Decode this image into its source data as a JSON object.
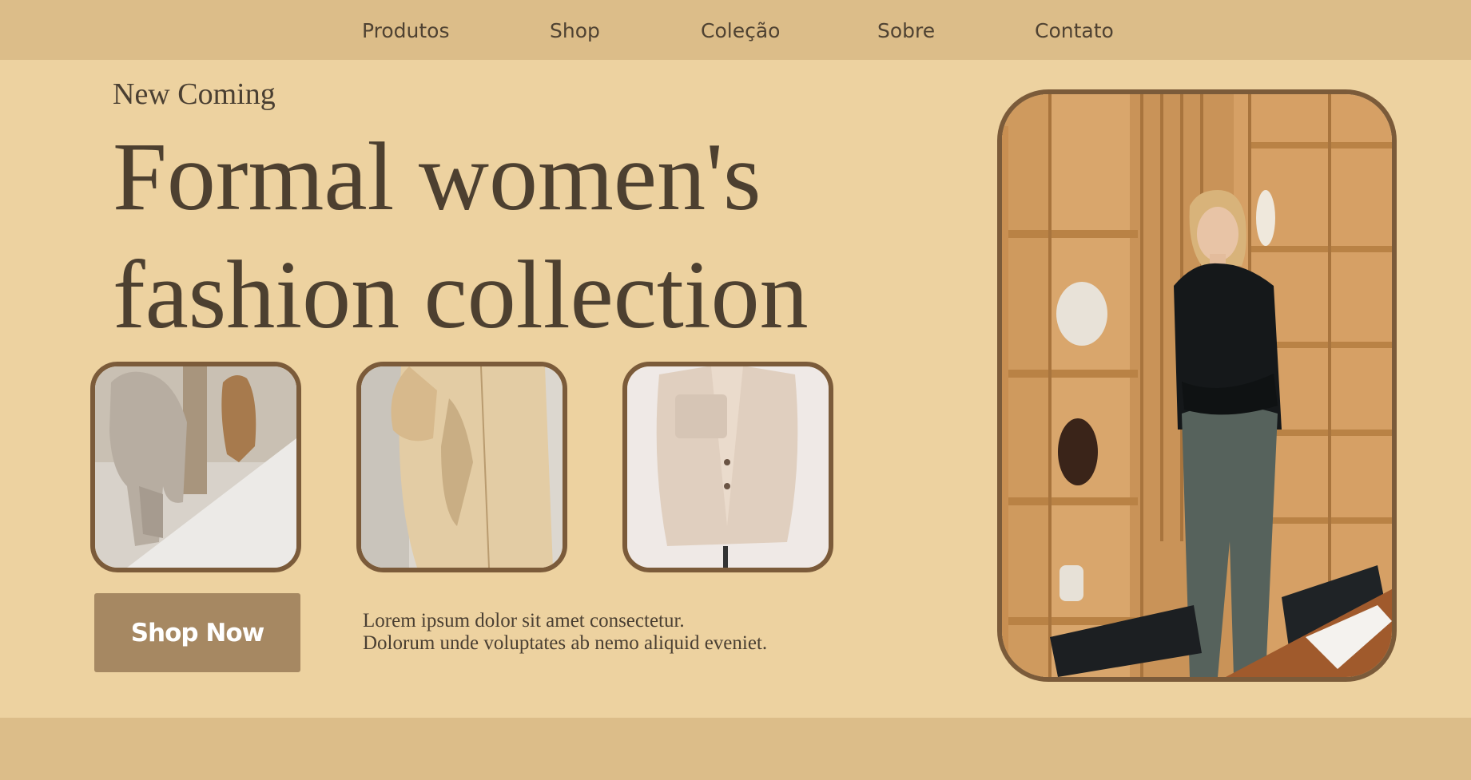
{
  "nav": {
    "items": [
      {
        "label": "Produtos"
      },
      {
        "label": "Shop"
      },
      {
        "label": "Coleção"
      },
      {
        "label": "Sobre"
      },
      {
        "label": "Contato"
      }
    ]
  },
  "hero": {
    "kicker": "New Coming",
    "headline_line1": "Formal women's",
    "headline_line2": "fashion collection",
    "cta_label": "Shop Now",
    "description_line1": "Lorem ipsum dolor sit amet consectetur.",
    "description_line2": "Dolorum unde voluptates ab nemo aliquid eveniet."
  },
  "colors": {
    "page_background": "#EDD2A0",
    "nav_background": "#DCBD89",
    "frame_border": "#7B5B3A",
    "button": "#A68862",
    "text": "#4D4030"
  }
}
